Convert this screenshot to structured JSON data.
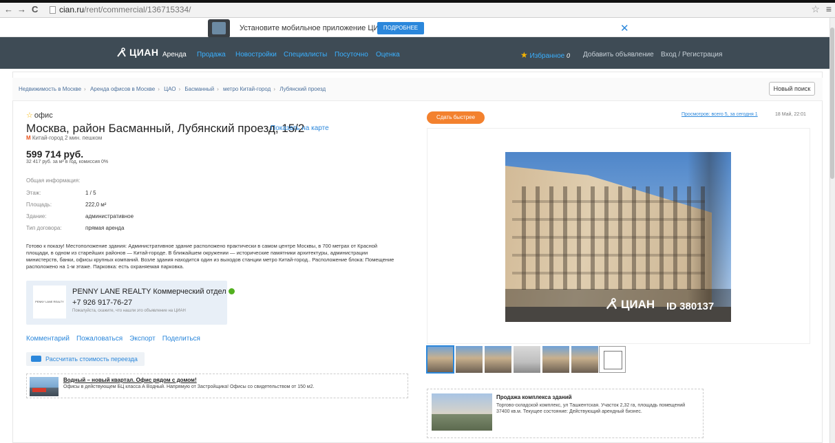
{
  "browser": {
    "back": "←",
    "forward": "→",
    "reload": "C",
    "url_host": "cian.ru",
    "url_path": "/rent/commercial/136715334/",
    "bookmark": "☆",
    "menu": "≡"
  },
  "app_banner": {
    "text": "Установите мобильное приложение ЦИАН",
    "button": "ПОДРОБНЕЕ",
    "close": "✕"
  },
  "header": {
    "logo": "ЦИАН",
    "nav": [
      "Аренда",
      "Продажа",
      "Новостройки",
      "Специалисты",
      "Посуточно",
      "Оценка"
    ],
    "favorites": "Избранное",
    "favorites_count": "0",
    "add_listing": "Добавить объявление",
    "login": "Вход / Регистрация"
  },
  "breadcrumb": [
    "Недвижимость в Москве",
    "Аренда офисов в Москве",
    "ЦАО",
    "Басманный",
    "метро Китай-город",
    "Лубянский проезд"
  ],
  "new_search": "Новый поиск",
  "listing": {
    "category": "офис",
    "title": "Москва, район Басманный, Лубянский проезд, 15/2",
    "show_map": "Показать на карте",
    "metro": "Китай-город 2 мин. пешком",
    "price": "599 714 руб.",
    "price_sub": "32 417 руб. за м² в год, комиссия 0%",
    "info_heading": "Общая информация:",
    "info": [
      {
        "label": "Этаж:",
        "value": "1 / 5"
      },
      {
        "label": "Площадь:",
        "value": "222,0 м²"
      },
      {
        "label": "Здание:",
        "value": "административное"
      },
      {
        "label": "Тип договора:",
        "value": "прямая аренда"
      }
    ],
    "description": "Готово к показу! Местоположение здания: Административное здание расположено практически в самом центре Москвы, в 700 метрах от Красной площади, в одном из старейших районов — Китай-городе. В ближайшем окружении — исторические памятники архитектуры, администрации министерств, банки, офисы крупных компаний. Возле здания находится один из выходов станции метро Китай-город.. Расположение блока: Помещение расположено на 1-м этаже. Парковка: есть охраняемая парковка."
  },
  "agent": {
    "logo_text": "PENNY LANE REALTY",
    "name": "PENNY LANE REALTY Коммерческий отдел",
    "phone": "+7 926 917-76-27",
    "note": "Пожалуйста, скажите, что нашли это объявление на ЦИАН"
  },
  "actions": [
    "Комментарий",
    "Пожаловаться",
    "Экспорт",
    "Поделиться"
  ],
  "calc_button": "Рассчитать стоимость переезда",
  "ad_left": {
    "title": "Водный – новый квартал. Офис рядом с домом!",
    "text": "Офисы в действующем БЦ класса А Водный. Напрямую от Застройщика! Офисы со свидетельством от 150 м2."
  },
  "right": {
    "fast_button": "Сдать быстрее",
    "views": "Просмотров: всего 5, за сегодня 1",
    "date": "18 Май, 22:01",
    "watermark_logo": "ЦИАН",
    "watermark_id": "ID 380137"
  },
  "ad_right": {
    "title": "Продажа комплекса зданий",
    "text": "Торгово-складской комплекс, ул Ташкентская. Участок 2,32 га, площадь помещений 37400 кв.м. Текущее состояние: Действующий арендный бизнес."
  },
  "colors": {
    "header_bg": "#3e4b55",
    "link": "#2b87db",
    "accent_orange": "#f3812e",
    "star": "#f6b400"
  }
}
